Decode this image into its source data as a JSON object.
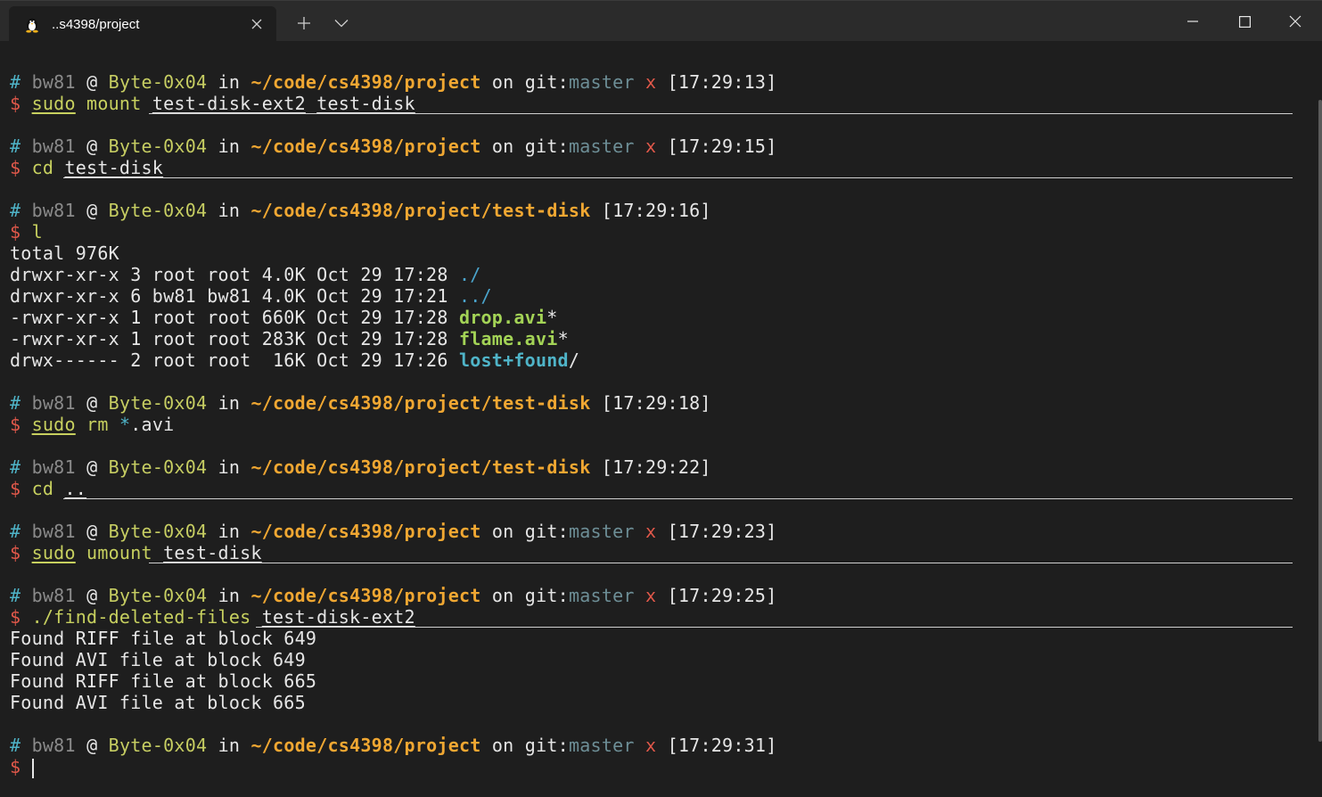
{
  "window": {
    "tab_title": "..s4398/project",
    "tab_icon": "tux-linux-icon"
  },
  "prompt": {
    "hash": "#",
    "user": "bw81",
    "at": "@",
    "host": "Byte-0x04",
    "in": "in",
    "on": "on",
    "git_label": "git:",
    "branch": "master",
    "dirty": "x",
    "dollar": "$"
  },
  "blocks": [
    {
      "path": "~/code/cs4398/project",
      "git": true,
      "time": "[17:29:13]",
      "command": [
        {
          "t": "sudo",
          "c": "cmd"
        },
        {
          "t": " mount ",
          "c": "cmdplain"
        },
        {
          "t": "test-disk-ext2",
          "c": "arg"
        },
        {
          "t": " ",
          "c": "plain"
        },
        {
          "t": "test-disk",
          "c": "arg"
        }
      ],
      "output": []
    },
    {
      "path": "~/code/cs4398/project",
      "git": true,
      "time": "[17:29:15]",
      "command": [
        {
          "t": "cd ",
          "c": "cmdplain"
        },
        {
          "t": "test-disk",
          "c": "arg"
        }
      ],
      "output": []
    },
    {
      "path": "~/code/cs4398/project/test-disk",
      "git": false,
      "time": "[17:29:16]",
      "command": [
        {
          "t": "l",
          "c": "cmdplain"
        }
      ],
      "output": [
        [
          {
            "t": "total 976K",
            "c": "plain"
          }
        ],
        [
          {
            "t": "drwxr-xr-x 3 root root 4.0K Oct 29 17:28 ",
            "c": "plain"
          },
          {
            "t": "./",
            "c": "dircol"
          }
        ],
        [
          {
            "t": "drwxr-xr-x 6 bw81 bw81 4.0K Oct 29 17:21 ",
            "c": "plain"
          },
          {
            "t": "../",
            "c": "dircol"
          }
        ],
        [
          {
            "t": "-rwxr-xr-x 1 root root 660K Oct 29 17:28 ",
            "c": "plain"
          },
          {
            "t": "drop.avi",
            "c": "exe"
          },
          {
            "t": "*",
            "c": "plain"
          }
        ],
        [
          {
            "t": "-rwxr-xr-x 1 root root 283K Oct 29 17:28 ",
            "c": "plain"
          },
          {
            "t": "flame.avi",
            "c": "exe"
          },
          {
            "t": "*",
            "c": "plain"
          }
        ],
        [
          {
            "t": "drwx------ 2 root root  16K Oct 29 17:26 ",
            "c": "plain"
          },
          {
            "t": "lost+found",
            "c": "lf"
          },
          {
            "t": "/",
            "c": "plain"
          }
        ]
      ]
    },
    {
      "path": "~/code/cs4398/project/test-disk",
      "git": false,
      "time": "[17:29:18]",
      "command": [
        {
          "t": "sudo",
          "c": "cmd"
        },
        {
          "t": " rm ",
          "c": "cmdplain"
        },
        {
          "t": "*",
          "c": "glob"
        },
        {
          "t": ".avi",
          "c": "plain"
        }
      ],
      "output": []
    },
    {
      "path": "~/code/cs4398/project/test-disk",
      "git": false,
      "time": "[17:29:22]",
      "command": [
        {
          "t": "cd ",
          "c": "cmdplain"
        },
        {
          "t": "..",
          "c": "arg"
        }
      ],
      "output": []
    },
    {
      "path": "~/code/cs4398/project",
      "git": true,
      "time": "[17:29:23]",
      "command": [
        {
          "t": "sudo",
          "c": "cmd"
        },
        {
          "t": " umount ",
          "c": "cmdplain"
        },
        {
          "t": "test-disk",
          "c": "arg"
        }
      ],
      "output": []
    },
    {
      "path": "~/code/cs4398/project",
      "git": true,
      "time": "[17:29:25]",
      "command": [
        {
          "t": "./find-deleted-files ",
          "c": "cmdplain"
        },
        {
          "t": "test-disk-ext2",
          "c": "arg"
        }
      ],
      "output": [
        [
          {
            "t": "Found RIFF file at block 649",
            "c": "plain"
          }
        ],
        [
          {
            "t": "Found AVI file at block 649",
            "c": "plain"
          }
        ],
        [
          {
            "t": "Found RIFF file at block 665",
            "c": "plain"
          }
        ],
        [
          {
            "t": "Found AVI file at block 665",
            "c": "plain"
          }
        ]
      ]
    },
    {
      "path": "~/code/cs4398/project",
      "git": true,
      "time": "[17:29:31]",
      "command": [],
      "output": []
    }
  ]
}
